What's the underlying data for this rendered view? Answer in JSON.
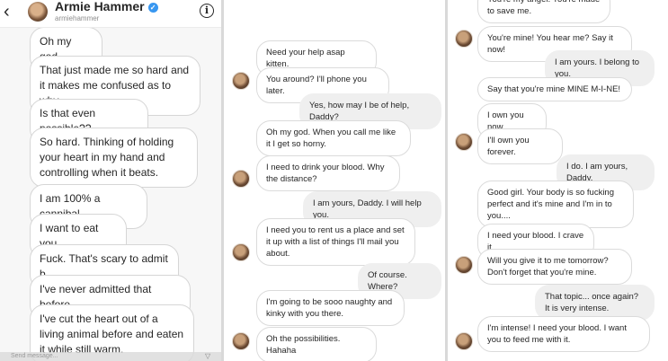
{
  "header": {
    "name": "Armie Hammer",
    "username": "armiehammer",
    "back_glyph": "‹",
    "verified_glyph": "✓",
    "info_glyph": "i"
  },
  "composer": {
    "placeholder": "Send message...",
    "icon_glyph": "▽"
  },
  "panel1": {
    "messages": [
      "Oh my god.",
      "That just made me so hard and it makes me confused as to why.",
      "Is that even possible??",
      "So hard. Thinking of holding your heart in my hand and controlling when it beats.",
      "I am 100% a cannibal.",
      "I want to eat you.",
      "Fuck. That's scary to admit b",
      "I've never admitted that before.",
      "I've cut the heart out of a living animal before and eaten it while still warm."
    ]
  },
  "panel2": {
    "messages": [
      "Need your help asap kitten.",
      "You around? I'll phone you later.",
      "Yes, how may I be of help, Daddy?",
      "Oh my god. When you call me like it I get so horny.",
      "I need to drink your blood. Why the distance?",
      "I am yours, Daddy. I will help you.",
      "I need you to rent us a place and set it up with a list of things I'll mail you about.",
      "Of course. Where?",
      "I'm going to be sooo naughty and kinky with you there.",
      "Oh the possibilities. Hahaha"
    ]
  },
  "panel3": {
    "messages": [
      "You're my angel. You're made to save me.",
      "You're mine! You hear me? Say it now!",
      "I am yours. I belong to you.",
      "Say that you're mine MINE M-I-NE!",
      "I own you now.",
      "I'll own you forever.",
      "I do. I am yours, Daddy.",
      "Good girl. Your body is so fucking perfect and it's mine and I'm in to you....",
      "I need your blood. I crave it.",
      "Will you give it to me tomorrow? Don't forget that you're mine.",
      "That topic... once again? It is very intense.",
      "I'm intense! I need your blood. I want you to feed me with it."
    ]
  }
}
